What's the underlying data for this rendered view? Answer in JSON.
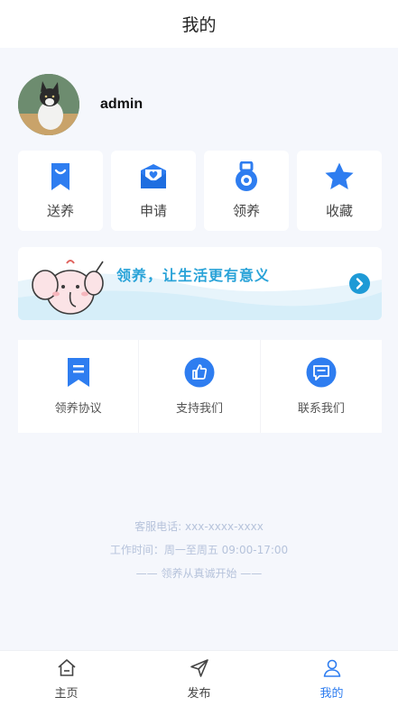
{
  "header": {
    "title": "我的"
  },
  "profile": {
    "username": "admin"
  },
  "quick_actions": [
    {
      "label": "送养",
      "icon": "bookmark-bag-icon"
    },
    {
      "label": "申请",
      "icon": "heart-mail-icon"
    },
    {
      "label": "领养",
      "icon": "medal-icon"
    },
    {
      "label": "收藏",
      "icon": "star-icon"
    }
  ],
  "banner": {
    "text": "领养，让生活更有意义",
    "icon": "arrow-right-circle-icon"
  },
  "services": [
    {
      "label": "领养协议",
      "icon": "bookmark-icon"
    },
    {
      "label": "支持我们",
      "icon": "thumbs-up-icon"
    },
    {
      "label": "联系我们",
      "icon": "message-icon"
    }
  ],
  "footer": {
    "phone": "客服电话: xxx-xxxx-xxxx",
    "hours": "工作时间：周一至周五 09:00-17:00",
    "slogan": "—— 领养从真诚开始 ——"
  },
  "tabbar": [
    {
      "label": "主页",
      "icon": "home-icon",
      "active": false
    },
    {
      "label": "发布",
      "icon": "send-icon",
      "active": false
    },
    {
      "label": "我的",
      "icon": "user-icon",
      "active": true
    }
  ],
  "colors": {
    "accent": "#2e7df0",
    "background": "#f5f7fc",
    "banner_text": "#2aa3d8"
  }
}
